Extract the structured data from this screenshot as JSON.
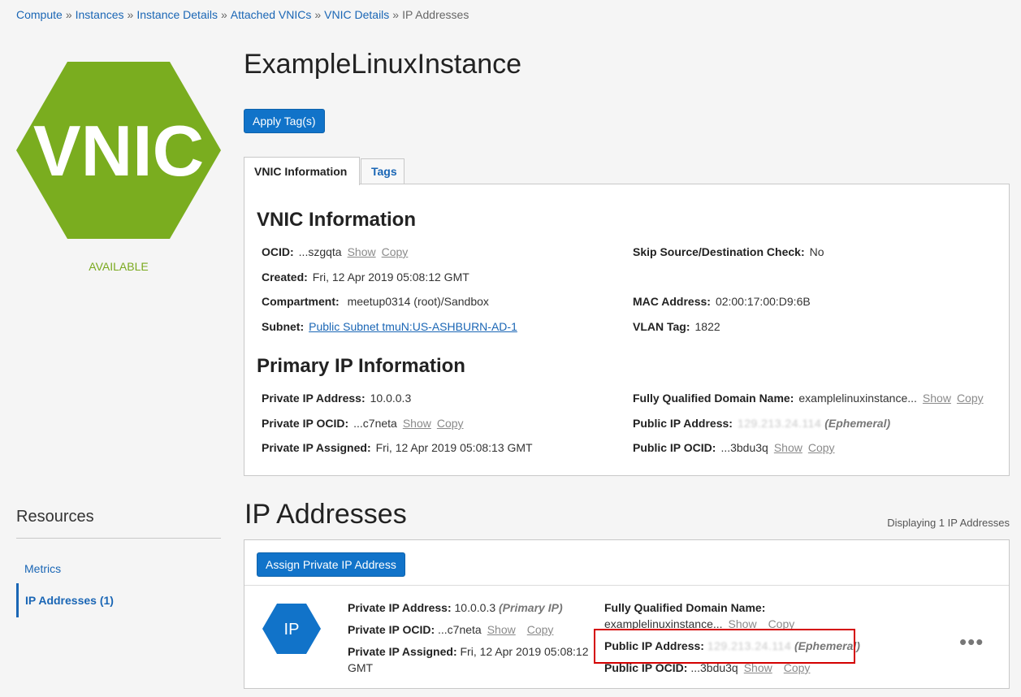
{
  "breadcrumb": {
    "items": [
      "Compute",
      "Instances",
      "Instance Details",
      "Attached VNICs",
      "VNIC Details"
    ],
    "current": "IP Addresses",
    "separator": "»"
  },
  "vnic_badge": {
    "text": "VNIC",
    "color": "#7aad1f",
    "status": "AVAILABLE"
  },
  "page_title": "ExampleLinuxInstance",
  "apply_tags_label": "Apply Tag(s)",
  "tabs": [
    {
      "label": "VNIC Information"
    },
    {
      "label": "Tags"
    }
  ],
  "vnic_info": {
    "heading": "VNIC Information",
    "ocid": {
      "label": "OCID:",
      "value": "...szgqta",
      "show": "Show",
      "copy": "Copy"
    },
    "created": {
      "label": "Created:",
      "value": "Fri, 12 Apr 2019 05:08:12 GMT"
    },
    "compartment": {
      "label": "Compartment:",
      "value": "meetup0314 (root)/Sandbox"
    },
    "subnet": {
      "label": "Subnet:",
      "value": "Public Subnet tmuN:US-ASHBURN-AD-1"
    },
    "skip_check": {
      "label": "Skip Source/Destination Check:",
      "value": "No"
    },
    "mac": {
      "label": "MAC Address:",
      "value": "02:00:17:00:D9:6B"
    },
    "vlan": {
      "label": "VLAN Tag:",
      "value": "1822"
    }
  },
  "primary_ip": {
    "heading": "Primary IP Information",
    "private_ip": {
      "label": "Private IP Address:",
      "value": "10.0.0.3"
    },
    "private_ocid": {
      "label": "Private IP OCID:",
      "value": "...c7neta",
      "show": "Show",
      "copy": "Copy"
    },
    "private_assigned": {
      "label": "Private IP Assigned:",
      "value": "Fri, 12 Apr 2019 05:08:13 GMT"
    },
    "fqdn": {
      "label": "Fully Qualified Domain Name:",
      "value": "examplelinuxinstance...",
      "show": "Show",
      "copy": "Copy"
    },
    "public_ip": {
      "label": "Public IP Address:",
      "value": "129.213.24.114",
      "tag": "(Ephemeral)"
    },
    "public_ocid": {
      "label": "Public IP OCID:",
      "value": "...3bdu3q",
      "show": "Show",
      "copy": "Copy"
    }
  },
  "resources": {
    "title": "Resources",
    "items": [
      {
        "label": "Metrics"
      },
      {
        "label": "IP Addresses (1)"
      }
    ]
  },
  "ip_section": {
    "title": "IP Addresses",
    "displaying": "Displaying 1 IP Addresses",
    "assign_label": "Assign Private IP Address",
    "item": {
      "badge": "IP",
      "badge_color": "#1173c9",
      "private_ip": {
        "label": "Private IP Address:",
        "value": "10.0.0.3",
        "tag": "(Primary IP)"
      },
      "private_ocid": {
        "label": "Private IP OCID:",
        "value": "...c7neta",
        "show": "Show",
        "copy": "Copy"
      },
      "private_assigned": {
        "label": "Private IP Assigned:",
        "value": "Fri, 12 Apr 2019 05:08:12 GMT"
      },
      "fqdn": {
        "label": "Fully Qualified Domain Name:",
        "value": "examplelinuxinstance...",
        "show": "Show",
        "copy": "Copy"
      },
      "public_ip": {
        "label": "Public IP Address:",
        "value": "129.213.24.114",
        "tag": "(Ephemeral)"
      },
      "public_ocid": {
        "label": "Public IP OCID:",
        "value": "...3bdu3q",
        "show": "Show",
        "copy": "Copy"
      },
      "actions": "•••"
    }
  }
}
